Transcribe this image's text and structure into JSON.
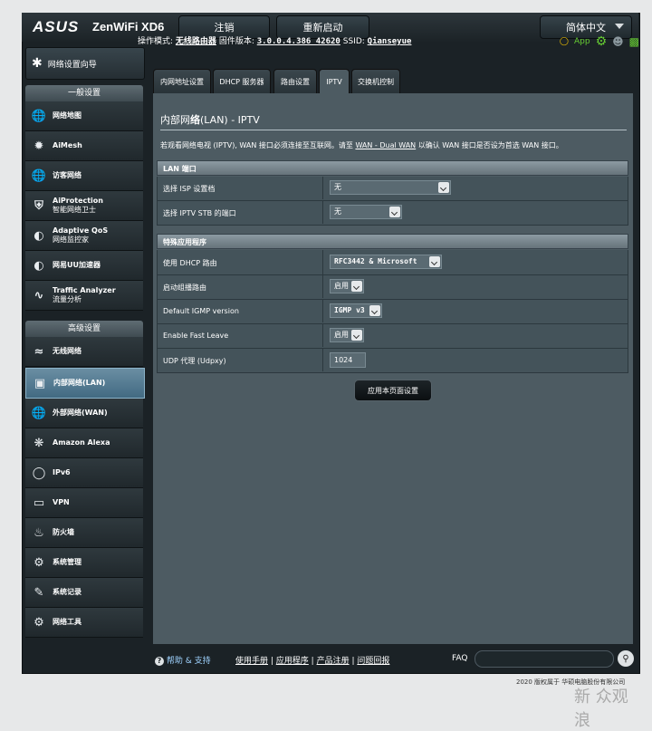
{
  "header": {
    "logo": "ASUS",
    "model": "ZenWiFi XD6",
    "logout": "注销",
    "reboot": "重新启动",
    "language": "简体中文",
    "mode_label": "操作模式:",
    "mode_value": "无线路由器",
    "firmware_label": "固件版本:",
    "firmware_value": "3.0.0.4.386_42620",
    "ssid_label": "SSID:",
    "ssid_value": "Qianseyue",
    "app_label": "App"
  },
  "sidebar": {
    "wizard": "网络设置向导",
    "general_title": "一般设置",
    "general_items": [
      {
        "label": "网络地图",
        "icon": "globe-icon"
      },
      {
        "label": "AiMesh",
        "icon": "mesh-icon"
      },
      {
        "label": "访客网络",
        "icon": "guest-network-icon"
      },
      {
        "label": "AiProtection",
        "label2": "智能网络卫士",
        "icon": "shield-icon"
      },
      {
        "label": "Adaptive QoS",
        "label2": "网络监控家",
        "icon": "gauge-icon"
      },
      {
        "label": "网易UU加速器",
        "icon": "speed-icon"
      },
      {
        "label": "Traffic Analyzer",
        "label2": "流量分析",
        "icon": "traffic-icon"
      }
    ],
    "advanced_title": "高级设置",
    "advanced_items": [
      {
        "label": "无线网络",
        "icon": "wifi-icon"
      },
      {
        "label": "内部网络(LAN)",
        "icon": "lan-icon"
      },
      {
        "label": "外部网络(WAN)",
        "icon": "wan-icon"
      },
      {
        "label": "Amazon Alexa",
        "icon": "alexa-icon"
      },
      {
        "label": "IPv6",
        "icon": "ipv6-icon"
      },
      {
        "label": "VPN",
        "icon": "vpn-icon"
      },
      {
        "label": "防火墙",
        "icon": "firewall-icon"
      },
      {
        "label": "系统管理",
        "icon": "admin-icon"
      },
      {
        "label": "系统记录",
        "icon": "log-icon"
      },
      {
        "label": "网络工具",
        "icon": "tools-icon"
      }
    ]
  },
  "tabs": [
    "内网地址设置",
    "DHCP 服务器",
    "路由设置",
    "IPTV",
    "交换机控制"
  ],
  "page": {
    "title_prefix": "内部网",
    "title_bold": "络",
    "title_suffix": "(LAN) - IPTV",
    "desc_1": "若观看网络电视 (IPTV), WAN 接口必须连接至互联网。请至 ",
    "desc_link": "WAN - Dual WAN",
    "desc_2": " 以确认 WAN 接口是否设为首选 WAN 接口。"
  },
  "lan_port": {
    "header": "LAN 端口",
    "rows": [
      {
        "label": "选择 ISP 设置档",
        "value": "无"
      },
      {
        "label": "选择 IPTV STB 的端口",
        "value": "无"
      }
    ]
  },
  "special": {
    "header": "特殊应用程序",
    "rows": [
      {
        "label": "使用 DHCP 路由",
        "value": "RFC3442 & Microsoft"
      },
      {
        "label": "启动组播路由",
        "value": "启用"
      },
      {
        "label": "Default IGMP version",
        "value": "IGMP v3"
      },
      {
        "label": "Enable Fast Leave",
        "value": "启用"
      },
      {
        "label": "UDP 代理 (Udpxy)",
        "value": "1024"
      }
    ]
  },
  "apply_button": "应用本页面设置",
  "footer": {
    "help": "帮助 & 支持",
    "links": [
      "使用手册",
      "应用程序",
      "产品注册",
      "问题回报"
    ],
    "faq": "FAQ",
    "copyright": "2020 版权属于 华硕电脑股份有限公司",
    "watermark": "新 众观 浪"
  }
}
